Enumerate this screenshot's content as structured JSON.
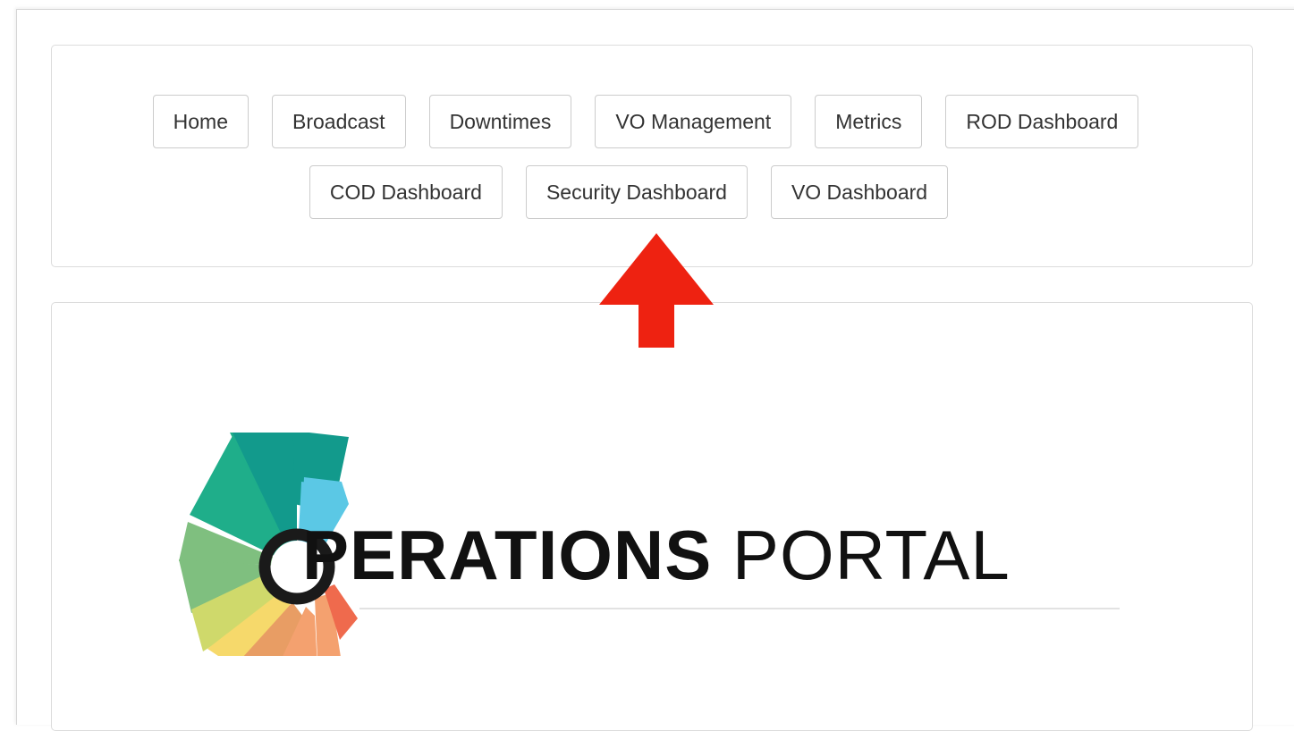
{
  "nav": {
    "row1": [
      "Home",
      "Broadcast",
      "Downtimes",
      "VO Management",
      "Metrics",
      "ROD Dashboard"
    ],
    "row2": [
      "COD Dashboard",
      "Security Dashboard",
      "VO Dashboard"
    ]
  },
  "logo": {
    "text_bold": "PERATIONS",
    "text_light": " PORTAL",
    "colors": [
      "#1fae8a",
      "#129a8c",
      "#5bc8e5",
      "#7fbf7f",
      "#cfd96b",
      "#f6d96b",
      "#e89d64",
      "#f4a16f",
      "#ef6a4d"
    ]
  },
  "annotation": {
    "arrow_color": "#ee2211",
    "arrow_icon": "up-arrow-icon"
  }
}
